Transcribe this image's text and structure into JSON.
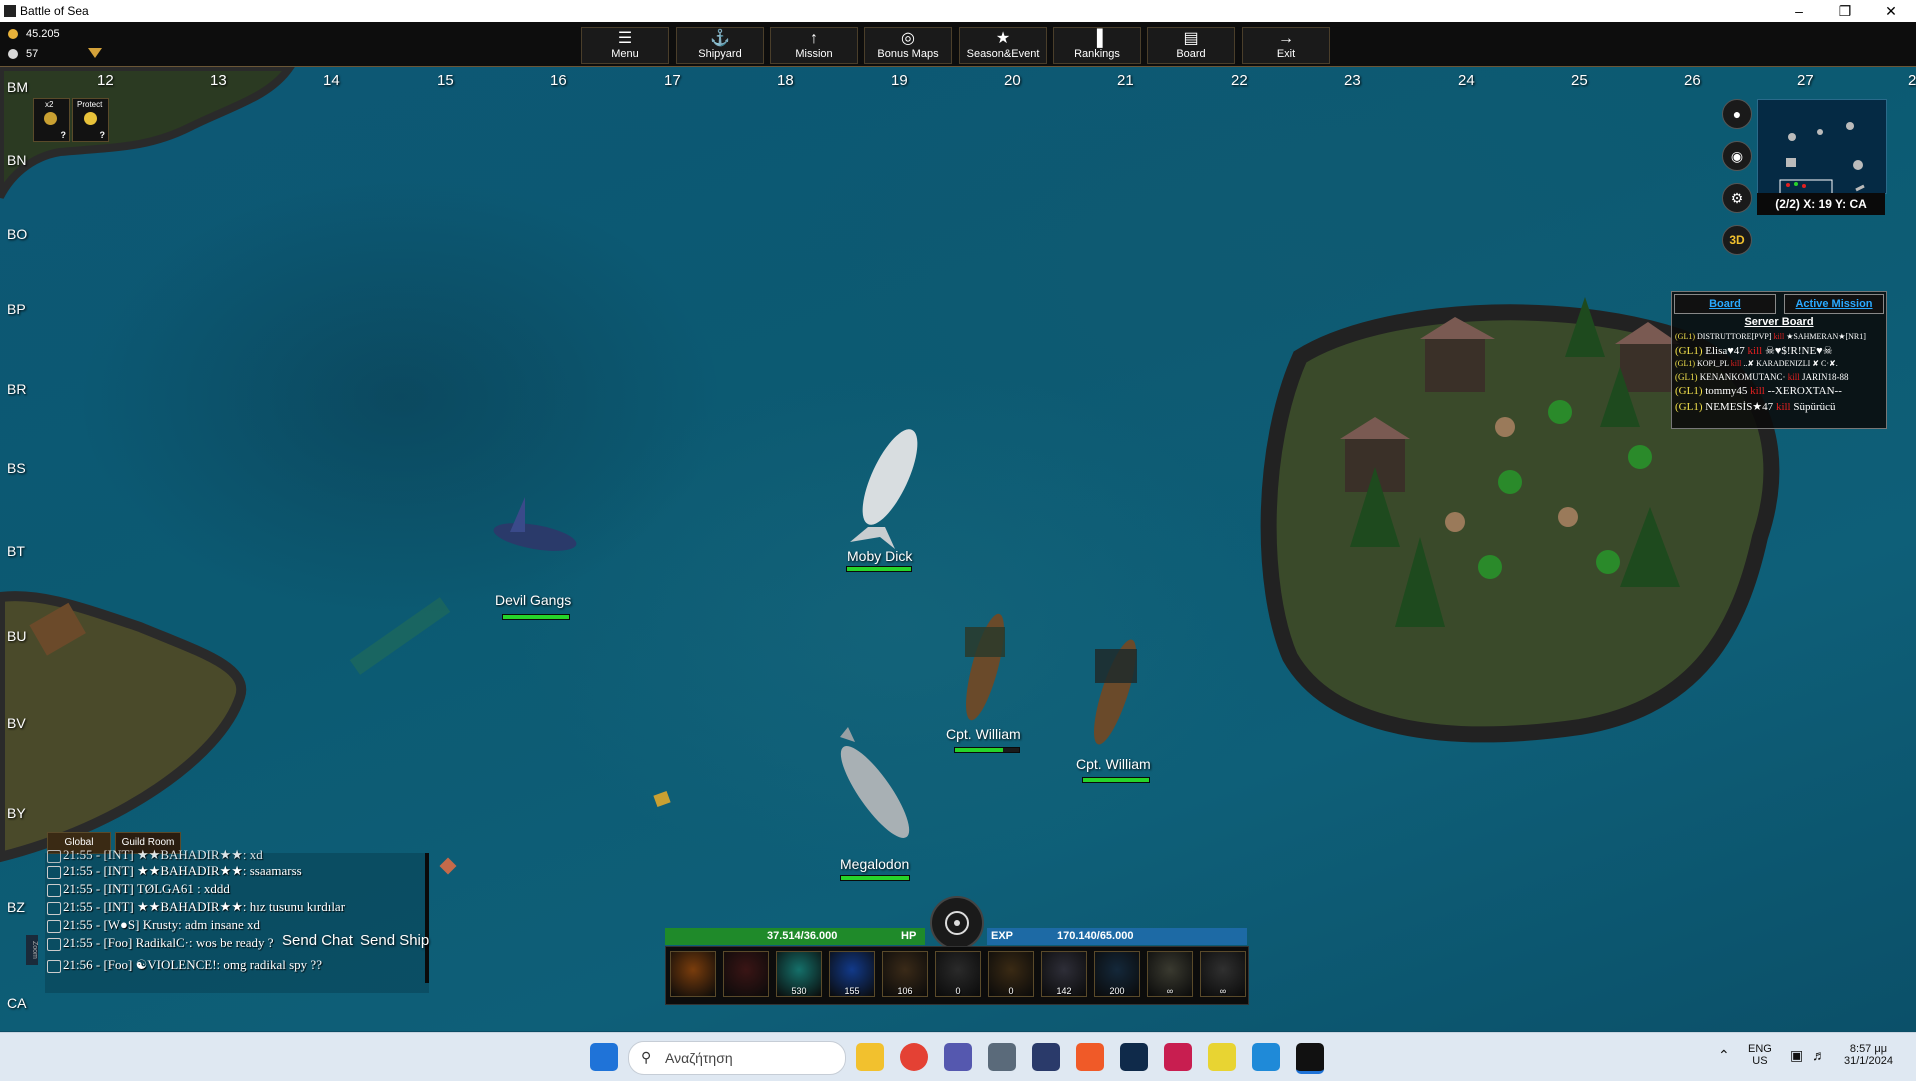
{
  "window": {
    "title": "Battle of Sea",
    "minimize": "–",
    "maximize": "❐",
    "close": "✕"
  },
  "resources": {
    "gold": "45.205",
    "pearls": "57"
  },
  "toolbar": {
    "items": [
      "Menu",
      "Shipyard",
      "Mission",
      "Bonus Maps",
      "Season&Event",
      "Rankings",
      "Board",
      "Exit"
    ],
    "icons": [
      "☰",
      "⚓",
      "↑",
      "◎",
      "★",
      "▐",
      "▤",
      "→"
    ]
  },
  "map": {
    "columns": [
      "12",
      "13",
      "14",
      "15",
      "16",
      "17",
      "18",
      "19",
      "20",
      "21",
      "22",
      "23",
      "24",
      "25",
      "26",
      "27",
      "2"
    ],
    "rows": [
      "BM",
      "BN",
      "BO",
      "BP",
      "BR",
      "BS",
      "BT",
      "BU",
      "BV",
      "BY",
      "BZ",
      "CA"
    ],
    "buffs": [
      {
        "label": "x2",
        "badge": "?"
      },
      {
        "label": "Protect",
        "badge": "?"
      }
    ],
    "coordinate": "(2/2) X: 19 Y: CA",
    "mode_button": "3D",
    "units": [
      {
        "name": "Moby Dick",
        "hp": 1.0
      },
      {
        "name": "Devil Gangs",
        "hp": 1.0
      },
      {
        "name": "Cpt. William",
        "hp": 0.75
      },
      {
        "name": "Cpt. William",
        "hp": 1.0
      },
      {
        "name": "Megalodon",
        "hp": 1.0
      }
    ]
  },
  "board": {
    "tabs": [
      "Board",
      "Active Mission"
    ],
    "header": "Server Board",
    "kills": [
      {
        "guild": "(GL1)",
        "killer": "DISTRUTTORE[PVP]",
        "word": "kill",
        "victim": "★SAHMERAN★[NR1]"
      },
      {
        "guild": "(GL1)",
        "killer": "Elisa♥47",
        "word": "kill",
        "victim": "☠♥$!R!NE♥☠"
      },
      {
        "guild": "(GL1)",
        "killer": "KOPI_PL",
        "word": "kill",
        "victim": "..✘ KARADENIZLI ✘ C·✘."
      },
      {
        "guild": "(GL1)",
        "killer": "KENANKOMUTANC·",
        "word": "kill",
        "victim": "JARIN18-88"
      },
      {
        "guild": "(GL1)",
        "killer": "tommy45",
        "word": "kill",
        "victim": "--XEROXTAN--"
      },
      {
        "guild": "(GL1)",
        "killer": "NEMESİS★47",
        "word": "kill",
        "victim": "Süpürücü"
      }
    ]
  },
  "chat": {
    "tabs": [
      "Global",
      "Guild Room"
    ],
    "lines": [
      "21:55 - [INT] ★★BAHADIR★★: xd",
      "21:55 - [INT] ★★BAHADIR★★: ssaamarss",
      "21:55 - [INT] TØLGA61 : xddd",
      "21:55 - [INT] ★★BAHADIR★★: hız tusunu kırdılar",
      "21:55 - [W●S] Krusty: adm insane xd",
      "21:55 - [Foo] RadikalC·: wos be ready ?",
      "21:56 - [Foo] ☯VIOLENCE!: omg radikal spy ??"
    ],
    "send_chat": "Send Chat",
    "send_ship": "Send Ship",
    "zoom": "Zoom"
  },
  "stats": {
    "hp": "37.514/36.000",
    "hp_label": "HP",
    "exp_label": "EXP",
    "exp": "170.140/65.000"
  },
  "skills": [
    {
      "name": "fire-skill",
      "count": "",
      "color": "#7a3d0c"
    },
    {
      "name": "cross-skill",
      "count": "",
      "color": "#3a1515"
    },
    {
      "name": "claw-skill",
      "count": "530",
      "color": "#15706a"
    },
    {
      "name": "vortex-skill",
      "count": "155",
      "color": "#123a8a"
    },
    {
      "name": "flame-shot",
      "count": "106",
      "color": "#3a2a18"
    },
    {
      "name": "smoke-bomb",
      "count": "0",
      "color": "#2a2a2a"
    },
    {
      "name": "barrel",
      "count": "0",
      "color": "#3a2a14"
    },
    {
      "name": "stone",
      "count": "142",
      "color": "#2e2e38"
    },
    {
      "name": "wave",
      "count": "200",
      "color": "#14283a"
    },
    {
      "name": "mine",
      "count": "∞",
      "color": "#3a3a30"
    },
    {
      "name": "cannon",
      "count": "∞",
      "color": "#303030"
    }
  ],
  "taskbar": {
    "search_placeholder": "Αναζήτηση",
    "lang": "ENG",
    "region": "US",
    "time": "8:57 μμ",
    "date": "31/1/2024"
  }
}
